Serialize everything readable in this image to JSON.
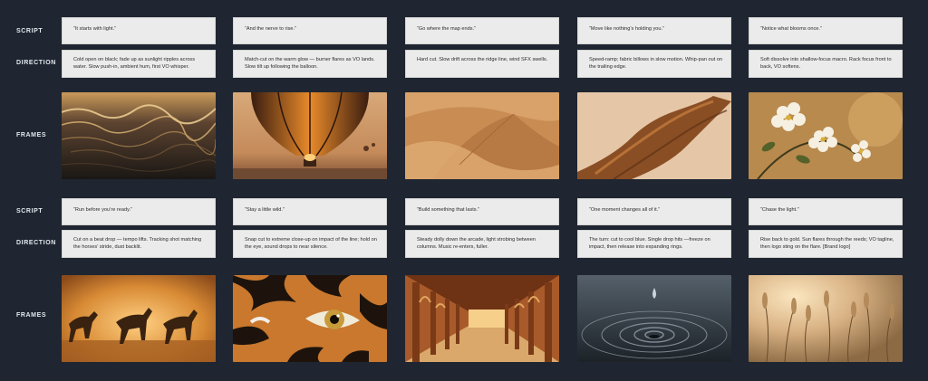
{
  "row_labels": {
    "script": "SCRIPT",
    "direction": "DIRECTION",
    "frames": "FRAMES"
  },
  "panels": [
    {
      "script": "“It starts with light.”",
      "direction": "Cold open on black; fade up as sunlight ripples across water. Slow push-in, ambient hum, first VO whisper.",
      "frame": "sunlit-water"
    },
    {
      "script": "“And the nerve to rise.”",
      "direction": "Match-cut on the warm glow — burner flares as VO lands. Slow tilt up following the balloon.",
      "frame": "hot-air-balloon"
    },
    {
      "script": "“Go where the map ends.”",
      "direction": "Hard cut. Slow drift across the ridge line, wind SFX swells.",
      "frame": "desert-dunes"
    },
    {
      "script": "“Move like nothing’s holding you.”",
      "direction": "Speed-ramp; fabric billows in slow motion. Whip-pan out on the trailing edge.",
      "frame": "flowing-fabric"
    },
    {
      "script": "“Notice what blooms once.”",
      "direction": "Soft dissolve into shallow-focus macro. Rack focus front to back, VO softens.",
      "frame": "white-blossoms"
    },
    {
      "script": "“Run before you’re ready.”",
      "direction": "Cut on a beat drop — tempo lifts. Tracking shot matching the horses’ stride, dust backlit.",
      "frame": "running-horses"
    },
    {
      "script": "“Stay a little wild.”",
      "direction": "Snap cut to extreme close-up on impact of the line; hold on the eye, sound drops to near silence.",
      "frame": "tiger-eye"
    },
    {
      "script": "“Build something that lasts.”",
      "direction": "Steady dolly down the arcade, light strobing between columns. Music re-enters, fuller.",
      "frame": "stone-arcade"
    },
    {
      "script": "“One moment changes all of it.”",
      "direction": "The turn: cut to cool blue. Single drop hits —freeze on impact, then release into expanding rings.",
      "frame": "water-drop-ripples"
    },
    {
      "script": "“Chase the light.”",
      "direction": "Rise back to gold. Sun flares through the reeds; VO tagline, then logo sting on the flare. [Brand logo]",
      "frame": "golden-reeds"
    }
  ]
}
